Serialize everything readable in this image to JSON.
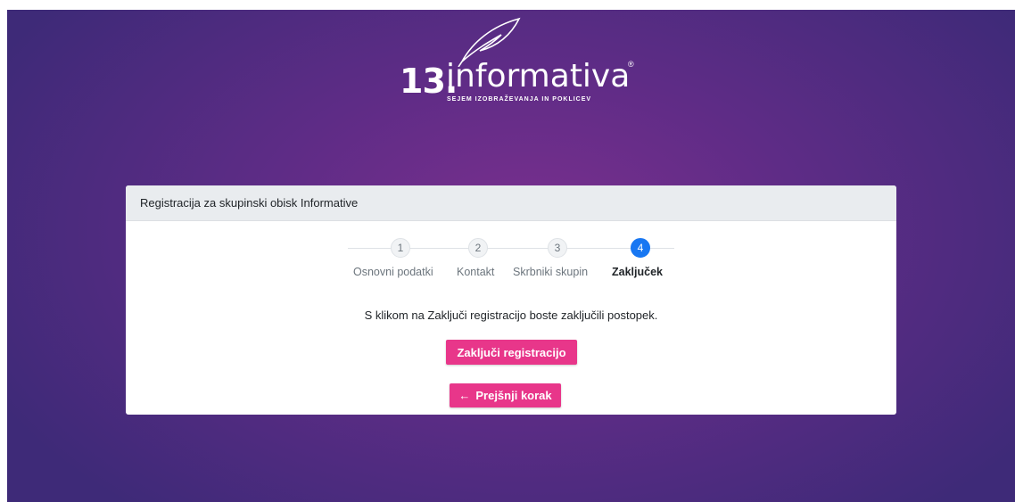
{
  "brand": {
    "number": "13.",
    "name": "informativa",
    "registered": "®",
    "tagline": "SEJEM IZOBRAŽEVANJA IN POKLICEV"
  },
  "card": {
    "title": "Registracija za skupinski obisk Informative"
  },
  "steps": [
    {
      "number": "1",
      "label": "Osnovni podatki",
      "active": false
    },
    {
      "number": "2",
      "label": "Kontakt",
      "active": false
    },
    {
      "number": "3",
      "label": "Skrbniki skupin",
      "active": false
    },
    {
      "number": "4",
      "label": "Zaključek",
      "active": true
    }
  ],
  "message": "S klikom na Zaključi registracijo boste zaključili postopek.",
  "buttons": {
    "finish_label": "Zaključi registracijo",
    "prev_label": "Prejšnji korak",
    "prev_icon": "arrow-left-icon"
  },
  "colors": {
    "accent": "#e8368a",
    "active_step": "#1877f2",
    "background": "#5e2c86"
  }
}
